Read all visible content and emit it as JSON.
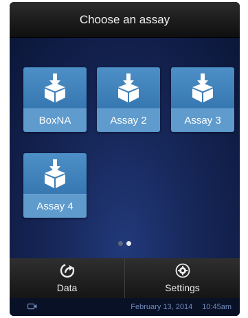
{
  "header": {
    "title": "Choose an assay"
  },
  "assays": [
    {
      "label": "BoxNA",
      "icon": "box-download-icon"
    },
    {
      "label": "Assay 2",
      "icon": "box-download-icon"
    },
    {
      "label": "Assay 3",
      "icon": "box-download-icon"
    },
    {
      "label": "Assay 4",
      "icon": "box-download-icon"
    }
  ],
  "pagination": {
    "pages": 2,
    "current": 2
  },
  "toolbar": {
    "data_label": "Data",
    "data_icon": "share-arrow-icon",
    "settings_label": "Settings",
    "settings_icon": "gear-icon"
  },
  "status": {
    "device_icon": "camera-icon",
    "date": "February 13, 2014",
    "time": "10:45am"
  },
  "colors": {
    "tile": "#3f80bd",
    "tile_label": "#5f9bcd",
    "background": "#17285b",
    "toolbar": "#222222",
    "status_text": "#6f86b7"
  }
}
